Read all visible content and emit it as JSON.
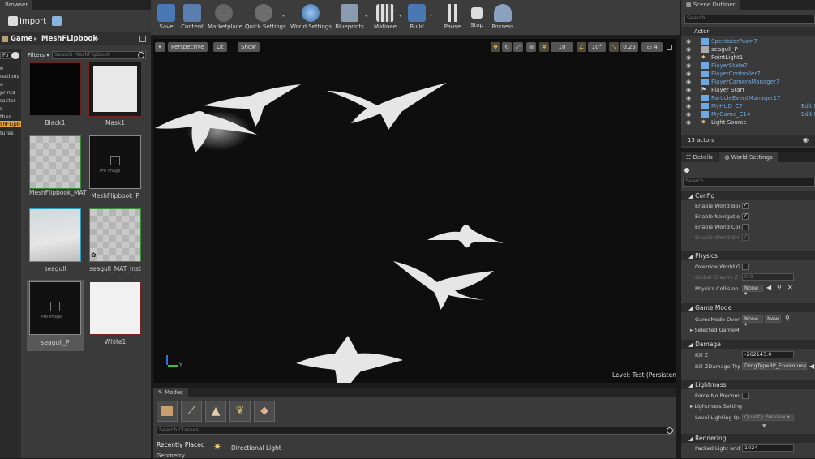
{
  "content_browser": {
    "tab": "Browser",
    "import_label": "Import",
    "path": [
      "Game",
      "MeshFLipbook"
    ],
    "filters_label": "Filters",
    "search_placeholder": "Search MeshFlipbook",
    "left_search_placeholder": "Fo",
    "tree_items": [
      "e",
      "nations",
      "o",
      "prints",
      "racter",
      "s",
      "thes",
      "shFLipb",
      "tures"
    ],
    "assets": [
      {
        "name": "Black1"
      },
      {
        "name": "Mask1"
      },
      {
        "name": "MeshFlipbook_MAT"
      },
      {
        "name": "MeshFlipbook_P",
        "badge": "Pre Image"
      },
      {
        "name": "seagull"
      },
      {
        "name": "seagull_MAT_Inst"
      },
      {
        "name": "seagull_P",
        "badge": "Pre Image"
      },
      {
        "name": "White1"
      }
    ]
  },
  "toolbar": {
    "buttons": [
      {
        "label": "Save"
      },
      {
        "label": "Content"
      },
      {
        "label": "Marketplace"
      },
      {
        "label": "Quick Settings"
      },
      {
        "label": "World Settings"
      },
      {
        "label": "Blueprints"
      },
      {
        "label": "Matinee"
      },
      {
        "label": "Build"
      },
      {
        "label": "Pause"
      },
      {
        "label": "Stop"
      },
      {
        "label": "Possess"
      }
    ]
  },
  "viewport": {
    "perspective_label": "Perspective",
    "lit_label": "Lit",
    "show_label": "Show",
    "grid_value": "10",
    "rotation_value": "10°",
    "scale_value": "0.25",
    "camera_speed": "4",
    "level_prefix": "Level:",
    "level_name": "Test (Persistent)",
    "axis_label": "Y"
  },
  "modes": {
    "tab": "Modes",
    "search_placeholder": "Search Classes",
    "category": "Recently Placed",
    "category_2": "Geometry",
    "item": "Directional Light"
  },
  "outliner": {
    "tab": "Scene Outliner",
    "search_placeholder": "Search",
    "column": "Actor",
    "actors": [
      {
        "name": "SpectatorPawn7",
        "color": "#6fa8e0"
      },
      {
        "name": "seagull_P",
        "color": "#d8d8d8"
      },
      {
        "name": "PointLight1",
        "color": "#d8d8d8"
      },
      {
        "name": "PlayerState7",
        "color": "#6fa8e0"
      },
      {
        "name": "PlayerController7",
        "color": "#6fa8e0"
      },
      {
        "name": "PlayerCameraManager7",
        "color": "#6fa8e0"
      },
      {
        "name": "Player Start",
        "color": "#d8d8d8"
      },
      {
        "name": "ParticleEventManager17",
        "color": "#6fa8e0"
      },
      {
        "name": "MyHUD_C7",
        "color": "#6fa8e0",
        "extra": "Edit M"
      },
      {
        "name": "MyGame_C14",
        "color": "#6fa8e0",
        "extra": "Edit M"
      },
      {
        "name": "Light Source",
        "color": "#d8d8d8"
      }
    ],
    "count": "15 actors"
  },
  "details": {
    "tab1": "Details",
    "tab2": "World Settings",
    "search_placeholder": "Search",
    "sections": {
      "config": "Config",
      "physics": "Physics",
      "game_mode": "Game Mode",
      "damage": "Damage",
      "lightmass": "Lightmass",
      "rendering": "Rendering"
    },
    "props": {
      "enable_world_bounds": "Enable World Bounds",
      "enable_navigation": "Enable Navigation S",
      "enable_world_comp": "Enable World Comp",
      "enable_world_origin": "Enable World Origi",
      "override_world_grav": "Override World Grav",
      "global_gravity_z": "Global Gravity Z",
      "global_gravity_value": "0.0",
      "physics_collision": "Physics Collision H",
      "none_1": "None",
      "gamemode_override": "GameMode Overrid",
      "none_2": "None",
      "new_label": "New..",
      "selected_gamemode": "Selected GameMo",
      "kill_z": "Kill Z",
      "kill_z_value": "-262143.0",
      "kill_z_damage_type": "Kill ZDamage Type",
      "damage_type_value": "DmgTypeBP_Environme",
      "force_no_precompute": "Force No Precomp",
      "lightmass_settings": "Lightmass Settings",
      "level_lighting_quality": "Level Lighting Qual",
      "quality_value": "Quality Preview",
      "packed_light": "Packed Light and S",
      "packed_light_value": "1024"
    }
  }
}
